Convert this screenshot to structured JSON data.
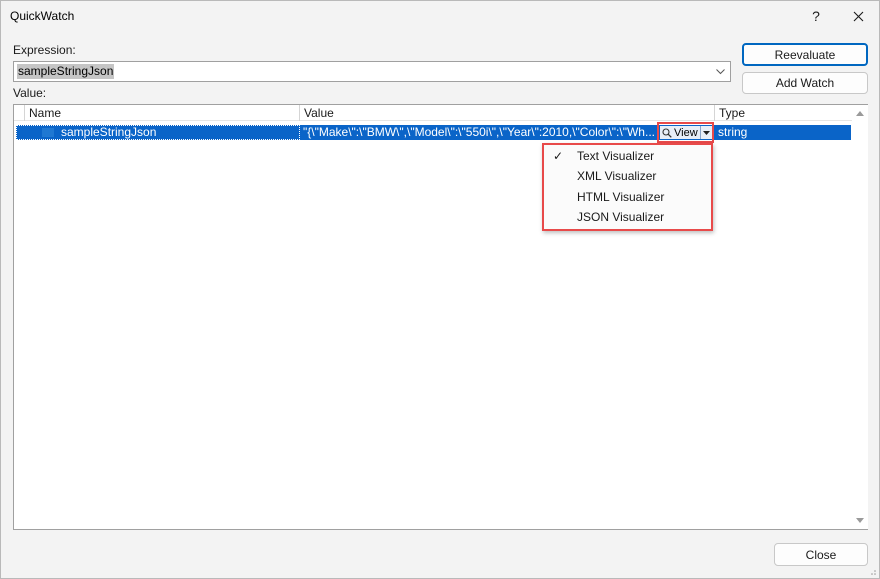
{
  "window": {
    "title": "QuickWatch",
    "help_label": "?",
    "close_icon": "close-icon"
  },
  "expression": {
    "label": "Expression:",
    "value": "sampleStringJson"
  },
  "buttons": {
    "reevaluate": "Reevaluate",
    "add_watch": "Add Watch",
    "close": "Close"
  },
  "value_section": {
    "label": "Value:"
  },
  "grid": {
    "columns": [
      "Name",
      "Value",
      "Type"
    ],
    "rows": [
      {
        "name": "sampleStringJson",
        "value": "\"{\\\"Make\\\":\\\"BMW\\\",\\\"Model\\\":\\\"550i\\\",\\\"Year\\\":2010,\\\"Color\\\":\\\"Wh...",
        "type": "string"
      }
    ],
    "view_button_label": "View"
  },
  "visualizer_menu": {
    "items": [
      {
        "label": "Text Visualizer",
        "checked": true
      },
      {
        "label": "XML Visualizer",
        "checked": false
      },
      {
        "label": "HTML Visualizer",
        "checked": false
      },
      {
        "label": "JSON Visualizer",
        "checked": false
      }
    ],
    "check_glyph": "✓"
  },
  "colors": {
    "selection": "#0a64c8",
    "accent": "#0067c0",
    "annotation": "#e84a4a"
  }
}
